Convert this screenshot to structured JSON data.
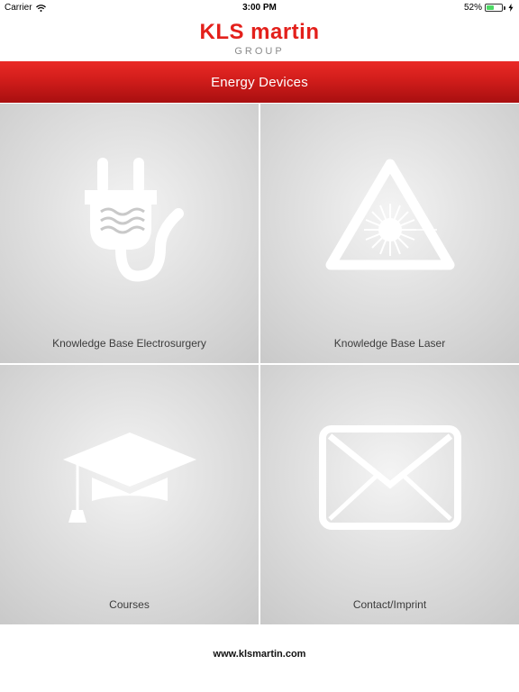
{
  "status_bar": {
    "carrier": "Carrier",
    "time": "3:00 PM",
    "battery_percent": "52%",
    "battery_level": 0.52,
    "battery_color": "#4cd964"
  },
  "header": {
    "logo_main": "KLS martin",
    "logo_sub": "GROUP",
    "brand_color": "#e3201b"
  },
  "title_bar": {
    "title": "Energy Devices",
    "color": "#d11d1b"
  },
  "tiles": [
    {
      "label": "Knowledge Base Electrosurgery",
      "icon": "plug-icon"
    },
    {
      "label": "Knowledge Base Laser",
      "icon": "laser-warning-icon"
    },
    {
      "label": "Courses",
      "icon": "graduation-cap-icon"
    },
    {
      "label": "Contact/Imprint",
      "icon": "envelope-icon"
    }
  ],
  "footer": {
    "link": "www.klsmartin.com"
  }
}
